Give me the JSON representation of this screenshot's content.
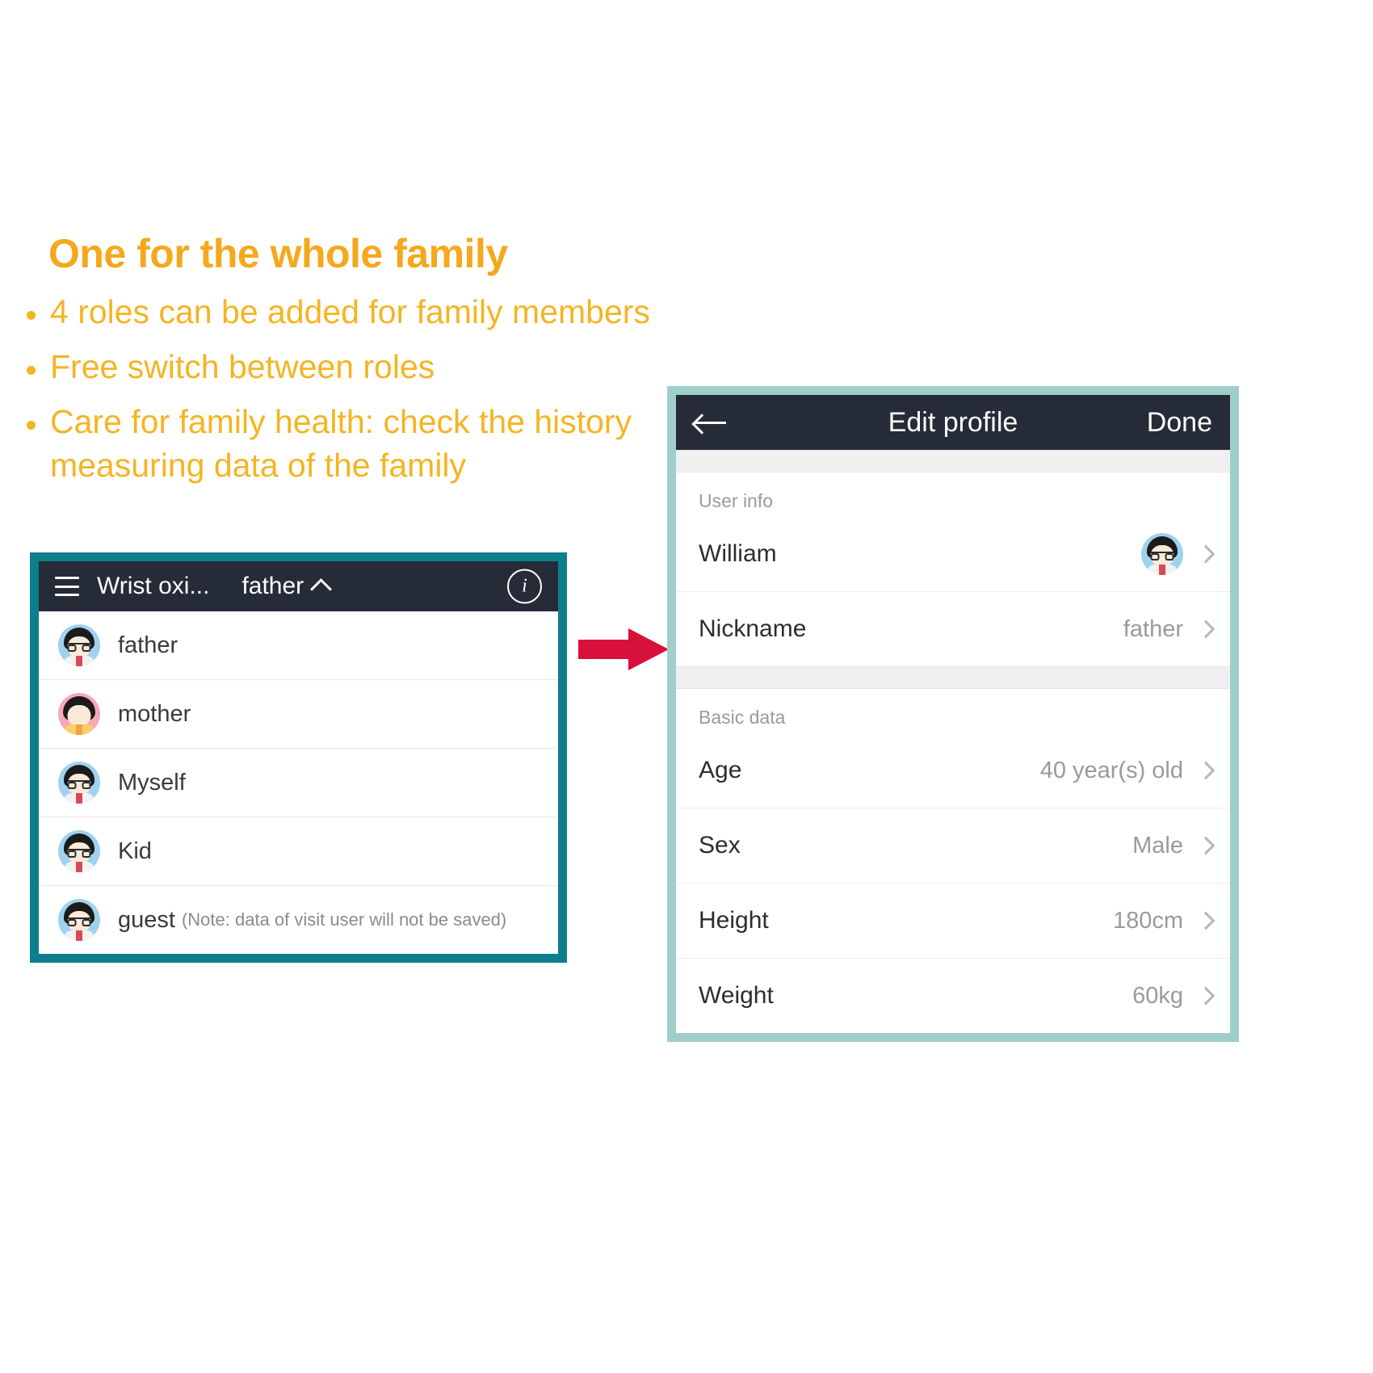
{
  "promo": {
    "title": "One for the whole family",
    "bullets": [
      "4 roles can be added for family members",
      "Free switch between roles",
      "Care for family health: check the history measuring data of the family"
    ],
    "accent_color": "#f5b422"
  },
  "left_phone": {
    "border_color": "#0d7e8c",
    "appbar": {
      "menu_icon": "hamburger-icon",
      "title": "Wrist oxi...",
      "current_role": "father",
      "caret_icon": "caret-up-icon",
      "info_icon": "info-icon",
      "info_glyph": "i",
      "background": "#262b38"
    },
    "members": [
      {
        "name": "father",
        "note": "",
        "avatar": "male-avatar"
      },
      {
        "name": "mother",
        "note": "",
        "avatar": "female-avatar"
      },
      {
        "name": "Myself",
        "note": "",
        "avatar": "male-avatar"
      },
      {
        "name": "Kid",
        "note": "",
        "avatar": "male-avatar"
      },
      {
        "name": "guest",
        "note": "(Note: data of visit user will not be saved)",
        "avatar": "male-avatar"
      }
    ]
  },
  "arrow": {
    "icon": "right-arrow-icon",
    "color": "#d8103c"
  },
  "right_phone": {
    "border_color": "#9ecfca",
    "appbar": {
      "back_icon": "back-arrow-icon",
      "title": "Edit profile",
      "done_label": "Done",
      "background": "#262b38"
    },
    "sections": [
      {
        "label": "User info",
        "rows": [
          {
            "label": "William",
            "value": "",
            "avatar": "male-avatar",
            "chevron": "chevron-right-icon"
          },
          {
            "label": "Nickname",
            "value": "father",
            "avatar": "",
            "chevron": "chevron-right-icon"
          }
        ]
      },
      {
        "label": "Basic data",
        "rows": [
          {
            "label": "Age",
            "value": "40 year(s) old",
            "avatar": "",
            "chevron": "chevron-right-icon"
          },
          {
            "label": "Sex",
            "value": "Male",
            "avatar": "",
            "chevron": "chevron-right-icon"
          },
          {
            "label": "Height",
            "value": "180cm",
            "avatar": "",
            "chevron": "chevron-right-icon"
          },
          {
            "label": "Weight",
            "value": "60kg",
            "avatar": "",
            "chevron": "chevron-right-icon"
          }
        ]
      }
    ]
  }
}
